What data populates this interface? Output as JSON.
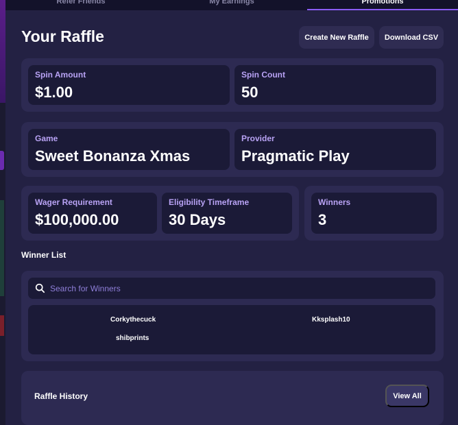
{
  "tabs": [
    "Refer Friends",
    "My Earnings",
    "Promotions"
  ],
  "page": {
    "title": "Your Raffle",
    "create_button": "Create New Raffle",
    "download_button": "Download CSV"
  },
  "stats": {
    "spin_amount": {
      "label": "Spin Amount",
      "value": "$1.00"
    },
    "spin_count": {
      "label": "Spin Count",
      "value": "50"
    },
    "game": {
      "label": "Game",
      "value": "Sweet Bonanza Xmas"
    },
    "provider": {
      "label": "Provider",
      "value": "Pragmatic Play"
    },
    "wager": {
      "label": "Wager Requirement",
      "value": "$100,000.00"
    },
    "timeframe": {
      "label": "Eligibility Timeframe",
      "value": "30 Days"
    },
    "winners": {
      "label": "Winners",
      "value": "3"
    }
  },
  "winner_list": {
    "title": "Winner List",
    "search_placeholder": "Search for Winners",
    "winners": [
      "Corkythecuck",
      "Kksplash10",
      "shibprints"
    ]
  },
  "history": {
    "title": "Raffle History",
    "view_all": "View All"
  },
  "colors": {
    "background": "#232143",
    "card": "#2d2a52",
    "tile": "#1b1a37",
    "label_accent": "#b9a3f5",
    "active_tab": "#8b5cf6"
  }
}
